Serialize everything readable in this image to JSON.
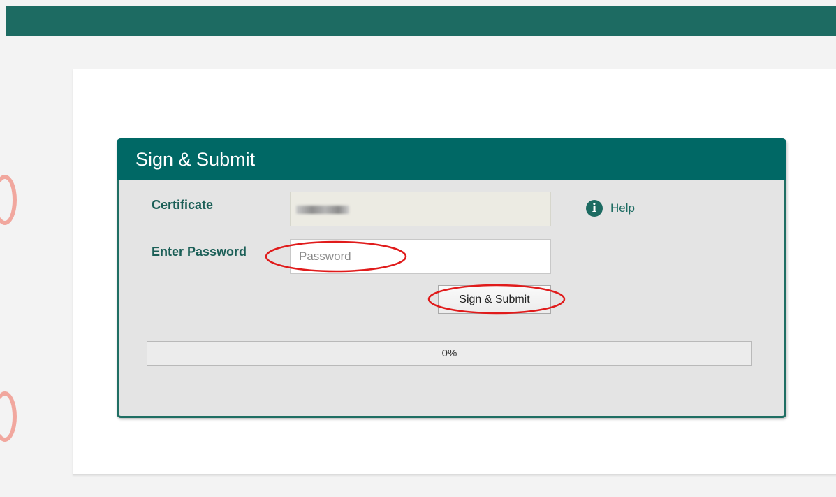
{
  "panel": {
    "title": "Sign & Submit"
  },
  "form": {
    "certificate_label": "Certificate",
    "password_label": "Enter Password",
    "password_placeholder": "Password",
    "password_value": ""
  },
  "help": {
    "icon": "info-icon",
    "icon_glyph": "i",
    "label": "Help"
  },
  "submit": {
    "label": "Sign & Submit"
  },
  "progress": {
    "text": "0%",
    "value": 0
  },
  "colors": {
    "brand": "#1d6b62",
    "panel_header": "#006865",
    "annotation": "#e01b1b"
  }
}
